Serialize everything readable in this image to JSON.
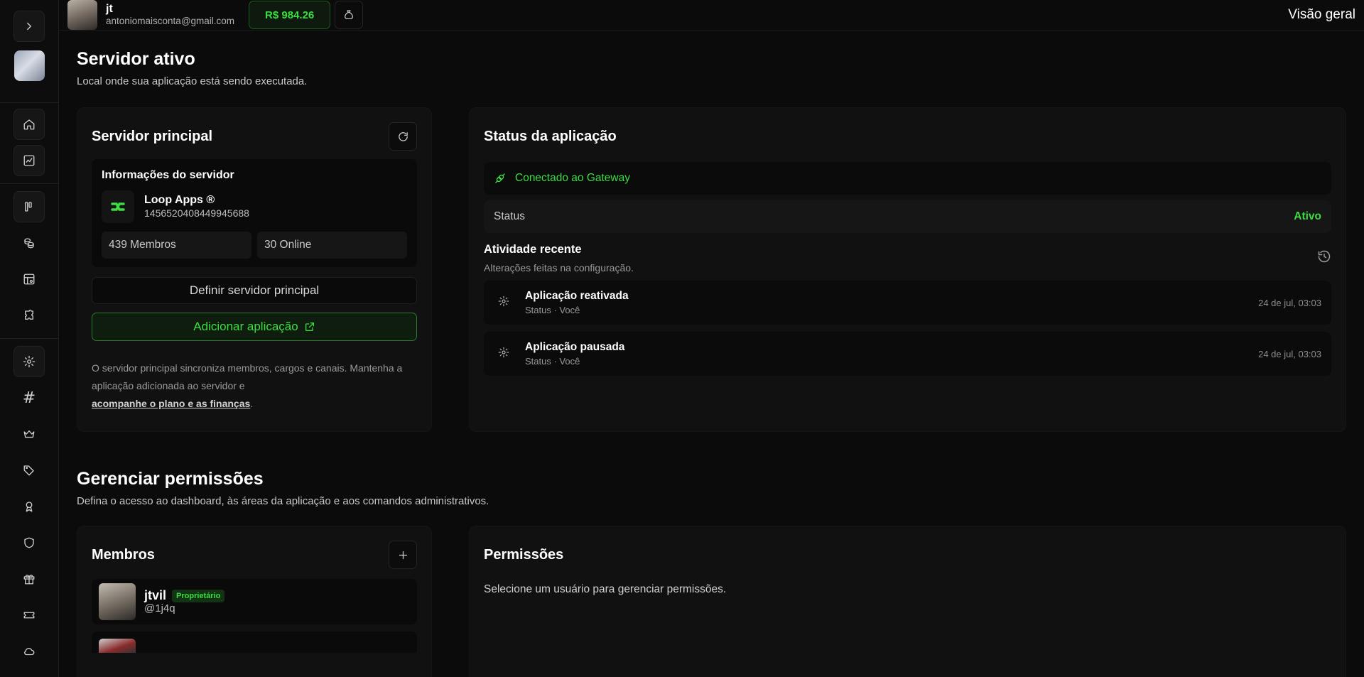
{
  "header": {
    "user_name": "jt",
    "user_email": "antoniomaisconta@gmail.com",
    "balance": "R$ 984.26",
    "page_title": "Visão geral"
  },
  "server_section": {
    "title": "Servidor ativo",
    "subtitle": "Local onde sua aplicação está sendo executada."
  },
  "main_server": {
    "title": "Servidor principal",
    "info_title": "Informações do servidor",
    "server_name": "Loop Apps ®",
    "server_id": "1456520408449945688",
    "members": "439 Membros",
    "online": "30 Online",
    "set_main_label": "Definir servidor principal",
    "add_app_label": "Adicionar aplicação",
    "hint_text": "O servidor principal sincroniza membros, cargos e canais. Mantenha a aplicação adicionada ao servidor e",
    "hint_link": "acompanhe o plano e as finanças",
    "hint_end": "."
  },
  "app_status": {
    "title": "Status da aplicação",
    "gateway": "Conectado ao Gateway",
    "status_label": "Status",
    "status_value": "Ativo",
    "activity_title": "Atividade recente",
    "activity_sub": "Alterações feitas na configuração.",
    "activity": [
      {
        "name": "Aplicação reativada",
        "meta": "Status · Você",
        "time": "24 de jul, 03:03"
      },
      {
        "name": "Aplicação pausada",
        "meta": "Status · Você",
        "time": "24 de jul, 03:03"
      }
    ]
  },
  "permissions_section": {
    "title": "Gerenciar permissões",
    "subtitle": "Defina o acesso ao dashboard, às áreas da aplicação e aos comandos administrativos."
  },
  "members_card": {
    "title": "Membros",
    "members": [
      {
        "name": "jtvil",
        "badge": "Proprietário",
        "handle": "@1j4q"
      }
    ]
  },
  "permissions_card": {
    "title": "Permissões",
    "empty_text": "Selecione um usuário para gerenciar permissões."
  },
  "colors": {
    "accent": "#3ddc43",
    "background": "#0b0b0b",
    "card": "#111111"
  }
}
